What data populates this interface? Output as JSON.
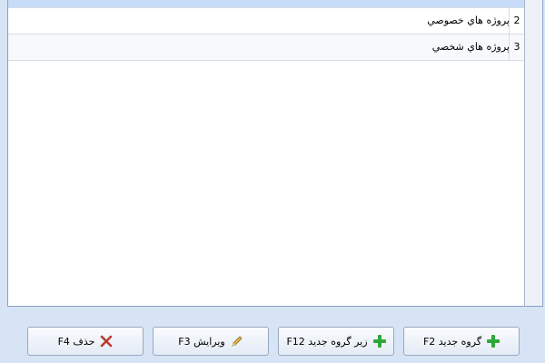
{
  "grid": {
    "rows": [
      {
        "num": "",
        "text": ""
      },
      {
        "num": "2",
        "text": "پروژه هاي خصوصي"
      },
      {
        "num": "3",
        "text": "پروژه هاي شخصي"
      }
    ]
  },
  "toolbar": {
    "new_group_label": "گروه جديد F2",
    "new_subgroup_label": "زير گروه جديد F12",
    "edit_label": "ويرايش F3",
    "delete_label": "حذف F4"
  },
  "icons": {
    "new_group": "plus-icon",
    "new_subgroup": "plus-icon",
    "edit": "pencil-icon",
    "delete": "x-icon"
  },
  "colors": {
    "accent_green": "#2ea83a",
    "selection": "#c6dcf8",
    "background": "#d6e4f5"
  }
}
